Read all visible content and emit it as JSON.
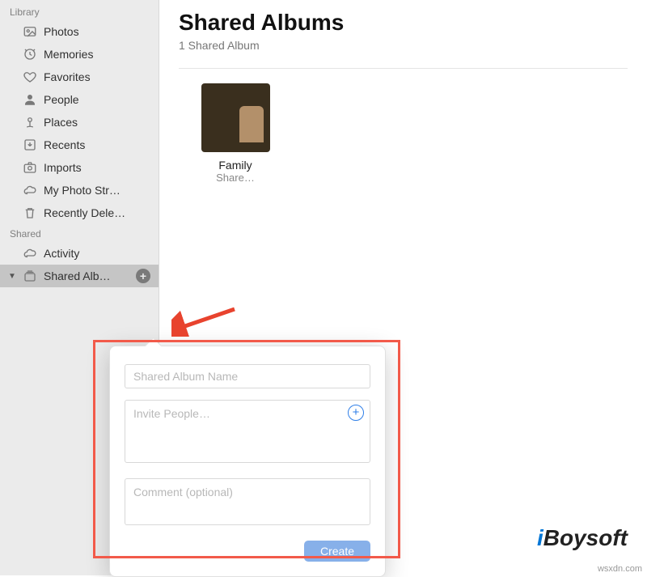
{
  "sidebar": {
    "library_header": "Library",
    "items": [
      {
        "label": "Photos"
      },
      {
        "label": "Memories"
      },
      {
        "label": "Favorites"
      },
      {
        "label": "People"
      },
      {
        "label": "Places"
      },
      {
        "label": "Recents"
      },
      {
        "label": "Imports"
      },
      {
        "label": "My Photo Str…"
      },
      {
        "label": "Recently Dele…"
      }
    ],
    "shared_header": "Shared",
    "shared_items": [
      {
        "label": "Activity"
      },
      {
        "label": "Shared Alb…"
      }
    ]
  },
  "main": {
    "title": "Shared Albums",
    "subtitle": "1 Shared Album",
    "album": {
      "name": "Family",
      "caption": "Share…"
    }
  },
  "popover": {
    "name_placeholder": "Shared Album Name",
    "invite_placeholder": "Invite People…",
    "comment_placeholder": "Comment (optional)",
    "create_label": "Create"
  },
  "watermark": {
    "brand_i": "i",
    "brand_rest": "Boysoft"
  },
  "source": "wsxdn.com"
}
